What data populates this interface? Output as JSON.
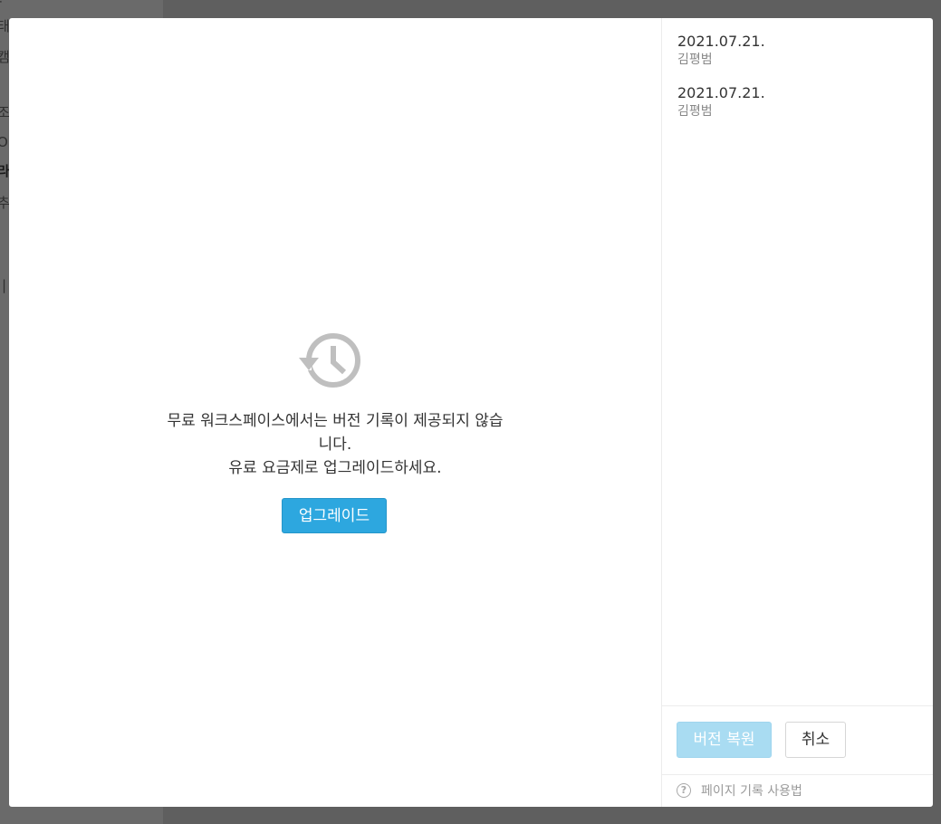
{
  "background": {
    "fragments": [
      "-",
      "태",
      "캠",
      "조",
      "O",
      "라",
      "추",
      "|"
    ]
  },
  "main": {
    "icon": "history-restore-icon",
    "message_line1": "무료 워크스페이스에서는 버전 기록이 제공되지 않습",
    "message_line2": "니다.",
    "message_line3": "유료 요금제로 업그레이드하세요.",
    "upgrade_label": "업그레이드"
  },
  "sidebar": {
    "versions": [
      {
        "date": "2021.07.21.",
        "author": "김평범"
      },
      {
        "date": "2021.07.21.",
        "author": "김평범"
      }
    ],
    "restore_label": "버전 복원",
    "cancel_label": "취소",
    "help_icon": "question-circle-icon",
    "help_label": "페이지 기록 사용법"
  },
  "colors": {
    "primary": "#2da7df",
    "primary_disabled": "#a9dcf2",
    "overlay": "#5f5f5f"
  }
}
